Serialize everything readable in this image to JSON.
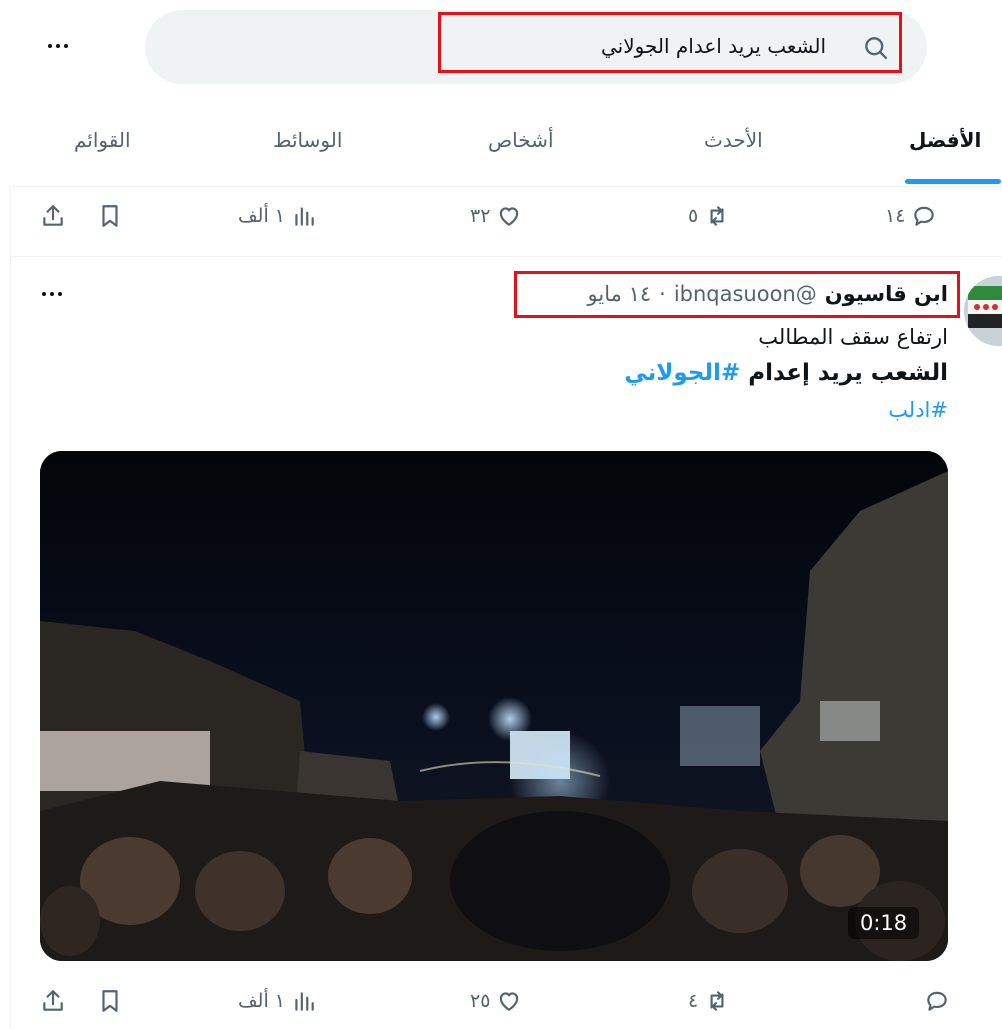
{
  "search": {
    "query": "الشعب يريد اعدام الجولاني"
  },
  "tabs": [
    {
      "label": "الأفضل",
      "active": true
    },
    {
      "label": "الأحدث",
      "active": false
    },
    {
      "label": "أشخاص",
      "active": false
    },
    {
      "label": "الوسائط",
      "active": false
    },
    {
      "label": "القوائم",
      "active": false
    }
  ],
  "previous_post_actions": {
    "replies": "١٤",
    "reposts": "٥",
    "likes": "٣٢",
    "views": "١ ألف"
  },
  "post": {
    "author_name": "ابن قاسيون",
    "author_handle": "@ibnqasuoon",
    "separator": "·",
    "date": "١٤ مايو",
    "text_line1": "ارتفاع سقف المطالب",
    "text_line2_plain": "الشعب يريد إعدام",
    "text_line2_hashtag": "#الجولاني",
    "text_line3_hashtag": "#ادلب",
    "video_duration": "0:18",
    "actions": {
      "replies": "",
      "reposts": "٤",
      "likes": "٢٥",
      "views": "١ ألف"
    }
  },
  "colors": {
    "accent": "#1d9bf0",
    "highlight_box": "#e3111a",
    "secondary_text": "#536471",
    "search_bg": "#eff3f4"
  }
}
